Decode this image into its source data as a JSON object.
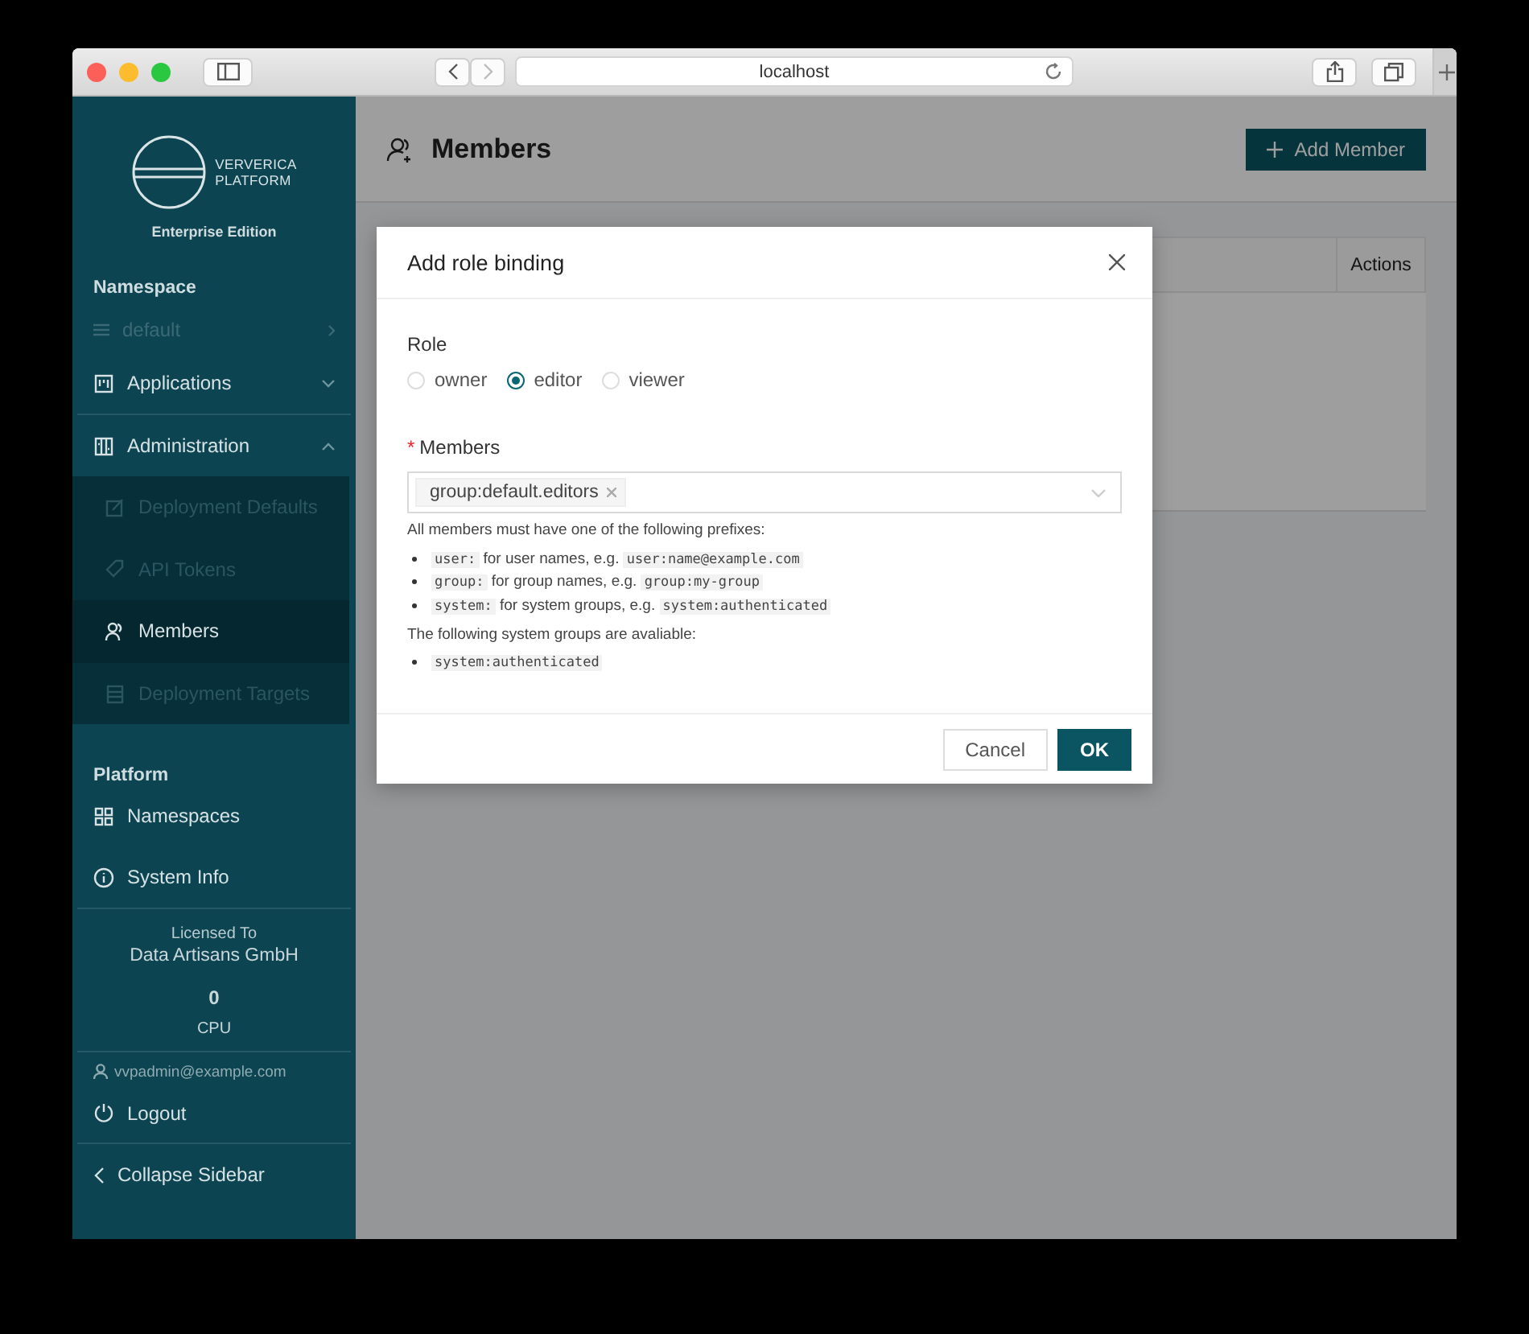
{
  "browser": {
    "address": "localhost"
  },
  "sidebar": {
    "logo_text": [
      "VERVERICA",
      "PLATFORM"
    ],
    "edition": "Enterprise Edition",
    "namespace_label": "Namespace",
    "namespace": {
      "value": "default",
      "disabled": true
    },
    "items": [
      {
        "label": "Applications",
        "kind": "board",
        "expanded": false
      },
      {
        "label": "Administration",
        "kind": "admin",
        "expanded": true,
        "children": [
          {
            "label": "Deployment Defaults",
            "kind": "edit",
            "disabled": true,
            "selected": false
          },
          {
            "label": "API Tokens",
            "kind": "tag",
            "disabled": true,
            "selected": false
          },
          {
            "label": "Members",
            "kind": "people",
            "disabled": false,
            "selected": true
          },
          {
            "label": "Deployment Targets",
            "kind": "list",
            "disabled": true,
            "selected": false
          }
        ]
      }
    ],
    "platform_label": "Platform",
    "platform_items": [
      {
        "label": "Namespaces",
        "kind": "grid"
      },
      {
        "label": "System Info",
        "kind": "info"
      }
    ],
    "license": {
      "label": "Licensed To",
      "holder": "Data Artisans GmbH",
      "cpu_value": "0",
      "cpu_label": "CPU"
    },
    "user": "vvpadmin@example.com",
    "logout": "Logout",
    "collapse": "Collapse Sidebar"
  },
  "page": {
    "title": "Members",
    "add_button": "Add Member",
    "table": {
      "columns": [
        "Actions"
      ]
    }
  },
  "dialog": {
    "title": "Add role binding",
    "role_label": "Role",
    "roles": [
      {
        "label": "owner",
        "selected": false
      },
      {
        "label": "editor",
        "selected": true
      },
      {
        "label": "viewer",
        "selected": false
      }
    ],
    "members_label": "Members",
    "required_mark": "*",
    "members": [
      "group:default.editors"
    ],
    "help": "All members must have one of the following prefixes:",
    "prefixes": [
      {
        "prefix": "user:",
        "text": " for user names, e.g. ",
        "example": "user:name@example.com"
      },
      {
        "prefix": "group:",
        "text": " for group names, e.g. ",
        "example": "group:my-group"
      },
      {
        "prefix": "system:",
        "text": " for system groups, e.g. ",
        "example": "system:authenticated"
      }
    ],
    "groups_help": "The following system groups are avaliable:",
    "groups": [
      "system:authenticated"
    ],
    "buttons": [
      {
        "label": "Cancel",
        "kind": "secondary"
      },
      {
        "label": "OK",
        "kind": "primary"
      }
    ]
  }
}
